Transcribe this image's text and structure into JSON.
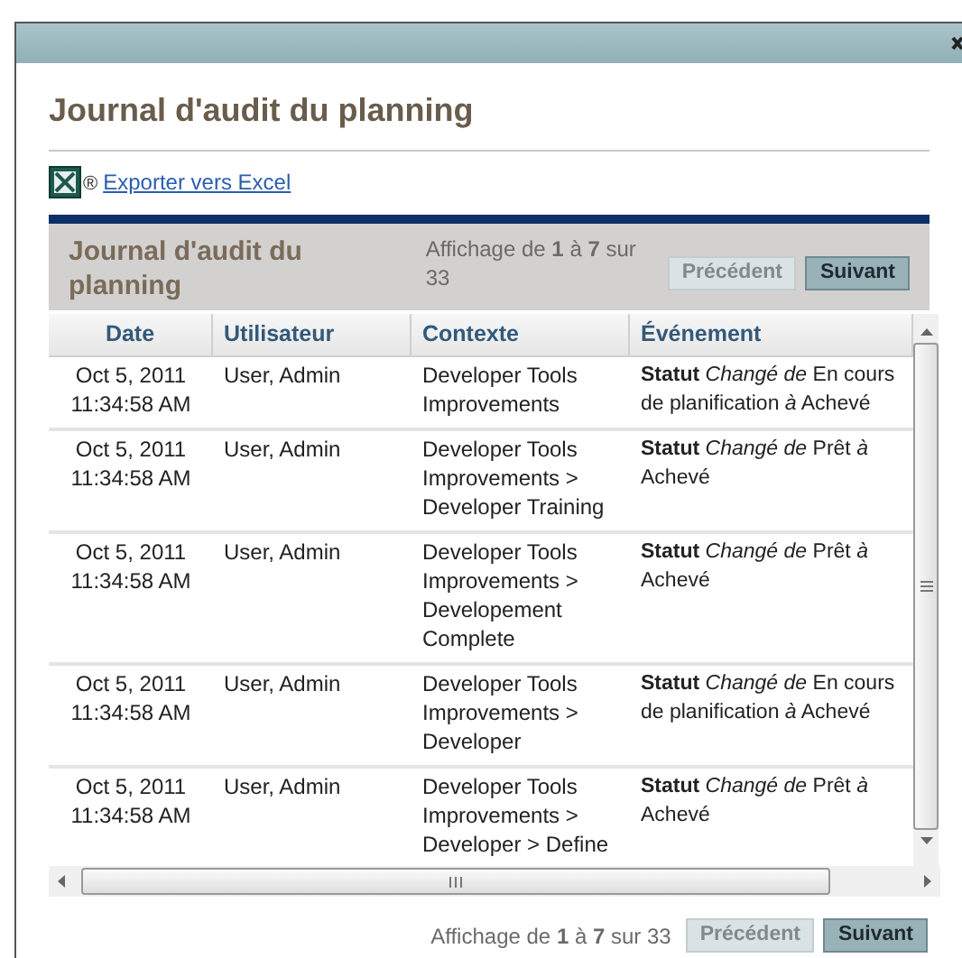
{
  "dialog": {
    "title": "Journal d'audit du planning",
    "export_link": "Exporter vers Excel",
    "export_mark": "®"
  },
  "panel": {
    "title": "Journal d'audit du planning",
    "paging": "Affichage de **1** à **7** sur 33",
    "buttons": [
      {
        "label": "Précédent",
        "disabled": true
      },
      {
        "label": "Suivant",
        "disabled": false
      }
    ]
  },
  "table": {
    "columns": [
      "Date",
      "Utilisateur",
      "Contexte",
      "Événement"
    ],
    "rows": [
      {
        "date": "Oct 5, 2011 11:34:58 AM",
        "user": "User, Admin",
        "context": "Developer Tools Improvements",
        "event": "**Statut** *Changé de* En cours de planification *à* Achevé"
      },
      {
        "date": "Oct 5, 2011 11:34:58 AM",
        "user": "User, Admin",
        "context": "Developer Tools Improvements > Developer Training",
        "event": "**Statut** *Changé de* Prêt *à* Achevé"
      },
      {
        "date": "Oct 5, 2011 11:34:58 AM",
        "user": "User, Admin",
        "context": "Developer Tools Improvements > Developement Complete",
        "event": "**Statut** *Changé de* Prêt *à* Achevé"
      },
      {
        "date": "Oct 5, 2011 11:34:58 AM",
        "user": "User, Admin",
        "context": "Developer Tools Improvements > Developer",
        "event": "**Statut** *Changé de* En cours de planification *à* Achevé"
      },
      {
        "date": "Oct 5, 2011 11:34:58 AM",
        "user": "User, Admin",
        "context": "Developer Tools Improvements > Developer > Define",
        "event": "**Statut** *Changé de* Prêt *à* Achevé"
      }
    ]
  },
  "footer": {
    "paging": "Affichage de **1** à **7** sur 33",
    "buttons": [
      {
        "label": "Précédent",
        "disabled": true
      },
      {
        "label": "Suivant",
        "disabled": false
      }
    ]
  }
}
